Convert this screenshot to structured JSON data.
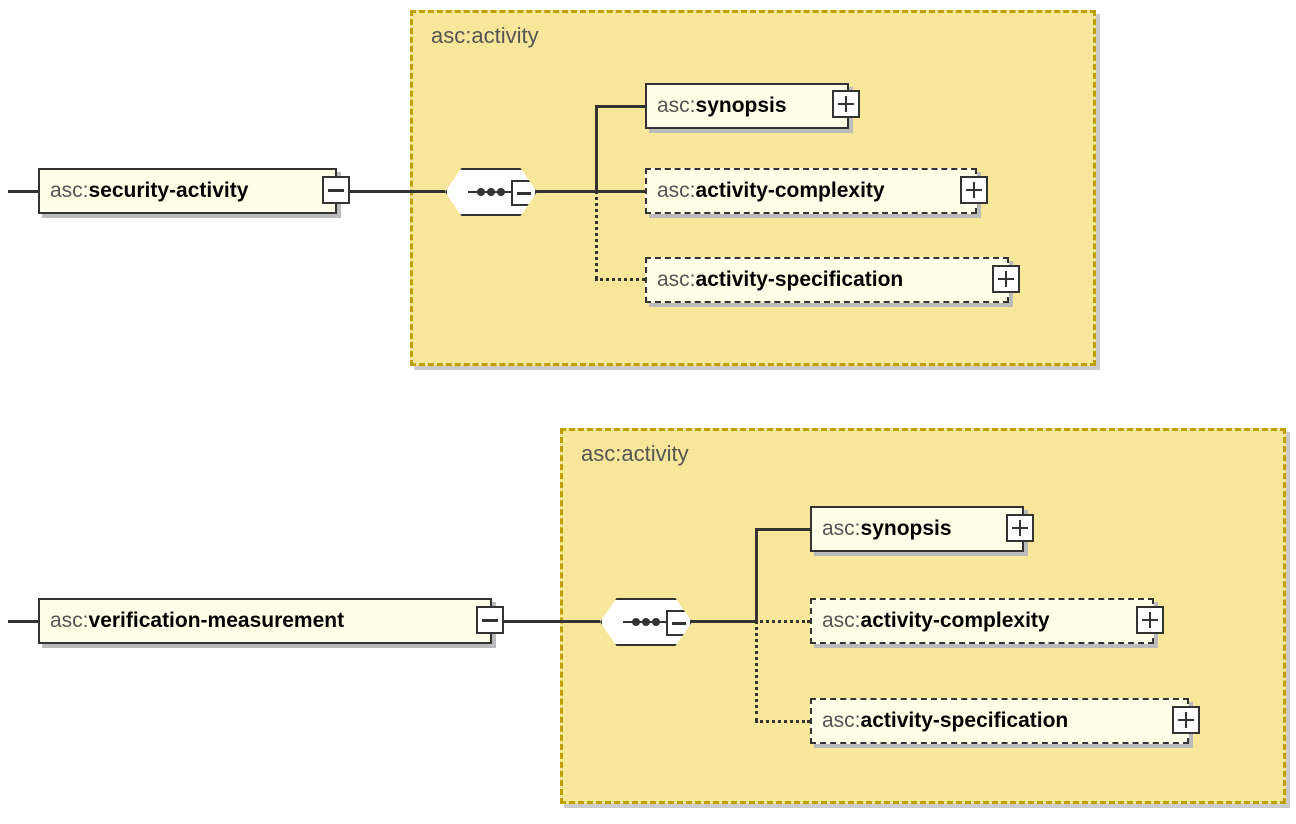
{
  "diagrams": [
    {
      "root": {
        "ns": "asc:",
        "name": "security-activity"
      },
      "group": {
        "label": "asc:activity"
      },
      "children": [
        {
          "ns": "asc:",
          "name": "synopsis",
          "optional": false
        },
        {
          "ns": "asc:",
          "name": "activity-complexity",
          "optional": true
        },
        {
          "ns": "asc:",
          "name": "activity-specification",
          "optional": true
        }
      ]
    },
    {
      "root": {
        "ns": "asc:",
        "name": "verification-measurement"
      },
      "group": {
        "label": "asc:activity"
      },
      "children": [
        {
          "ns": "asc:",
          "name": "synopsis",
          "optional": false
        },
        {
          "ns": "asc:",
          "name": "activity-complexity",
          "optional": true
        },
        {
          "ns": "asc:",
          "name": "activity-specification",
          "optional": true
        }
      ]
    }
  ],
  "colors": {
    "groupFill": "#f8e69b",
    "groupBorder": "#c0a000",
    "elementFill": "#ffffe8"
  }
}
